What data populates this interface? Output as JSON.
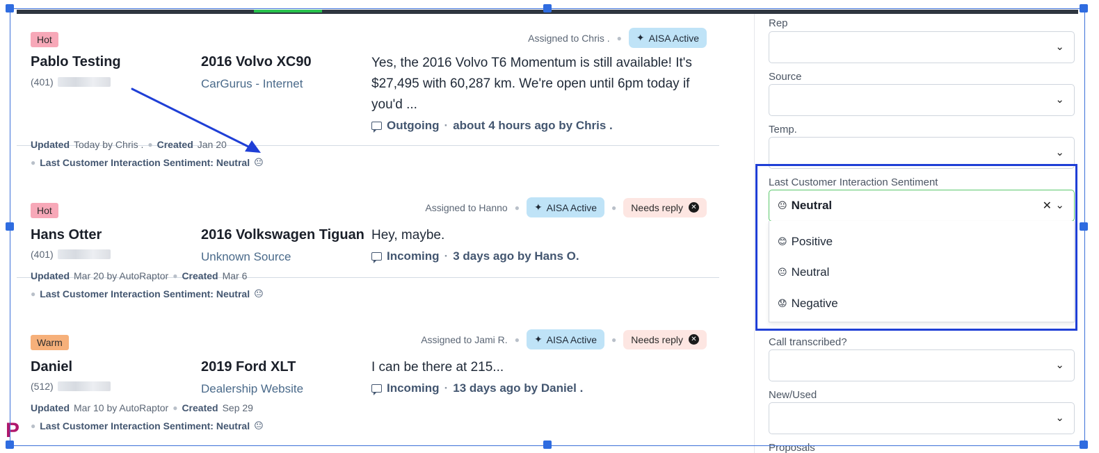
{
  "leads": [
    {
      "temp": "Hot",
      "assigned": "Assigned to Chris .",
      "aisa": "AISA Active",
      "needs_reply": "",
      "name": "Pablo Testing",
      "phone_prefix": "(401)",
      "vehicle": "2016 Volvo XC90",
      "source": "CarGurus - Internet",
      "message": "Yes, the 2016 Volvo T6 Momentum is still available! It's $27,495 with 60,287 km. We're open until 6pm today if you'd ...",
      "direction": "Outgoing",
      "when": "about 4 hours ago by Chris .",
      "updated_label": "Updated",
      "updated_value": "Today by Chris .",
      "created_label": "Created",
      "created_value": "Jan 20",
      "sentiment_label": "Last Customer Interaction Sentiment: Neutral",
      "sentiment_emoji": "😐"
    },
    {
      "temp": "Hot",
      "assigned": "Assigned to Hanno",
      "aisa": "AISA Active",
      "needs_reply": "Needs reply",
      "name": "Hans Otter",
      "phone_prefix": "(401)",
      "vehicle": "2016 Volkswagen Tiguan",
      "source": "Unknown Source",
      "message": "Hey, maybe.",
      "direction": "Incoming",
      "when": "3 days ago by Hans O.",
      "updated_label": "Updated",
      "updated_value": "Mar 20 by AutoRaptor",
      "created_label": "Created",
      "created_value": "Mar 6",
      "sentiment_label": "Last Customer Interaction Sentiment: Neutral",
      "sentiment_emoji": "😐"
    },
    {
      "temp": "Warm",
      "assigned": "Assigned to Jami R.",
      "aisa": "AISA Active",
      "needs_reply": "Needs reply",
      "name": "Daniel",
      "phone_prefix": "(512)",
      "vehicle": "2019 Ford XLT",
      "source": "Dealership Website",
      "message": "I can be there at 215...",
      "direction": "Incoming",
      "when": "13 days ago by Daniel .",
      "updated_label": "Updated",
      "updated_value": "Mar 10 by AutoRaptor",
      "created_label": "Created",
      "created_value": "Sep 29",
      "sentiment_label": "Last Customer Interaction Sentiment: Neutral",
      "sentiment_emoji": "😐"
    }
  ],
  "filters": {
    "rep_label": "Rep",
    "source_label": "Source",
    "temp_label": "Temp.",
    "sentiment_label": "Last Customer Interaction Sentiment",
    "sentiment_selected": "Neutral",
    "sentiment_selected_emoji": "😐",
    "sentiment_options": [
      {
        "emoji": "😊",
        "label": "Positive"
      },
      {
        "emoji": "😐",
        "label": "Neutral"
      },
      {
        "emoji": "😟",
        "label": "Negative"
      }
    ],
    "call_label": "Call transcribed?",
    "newused_label": "New/Used",
    "cut_label": "Proposals"
  },
  "colors": {
    "hot": "#f7a8b8",
    "warm": "#f6b07a",
    "aisa": "#bfe3f7",
    "needs_reply": "#fde6e2",
    "highlight": "#1f3fd6",
    "active_border": "#5ac86b"
  },
  "brand_mark": "P"
}
